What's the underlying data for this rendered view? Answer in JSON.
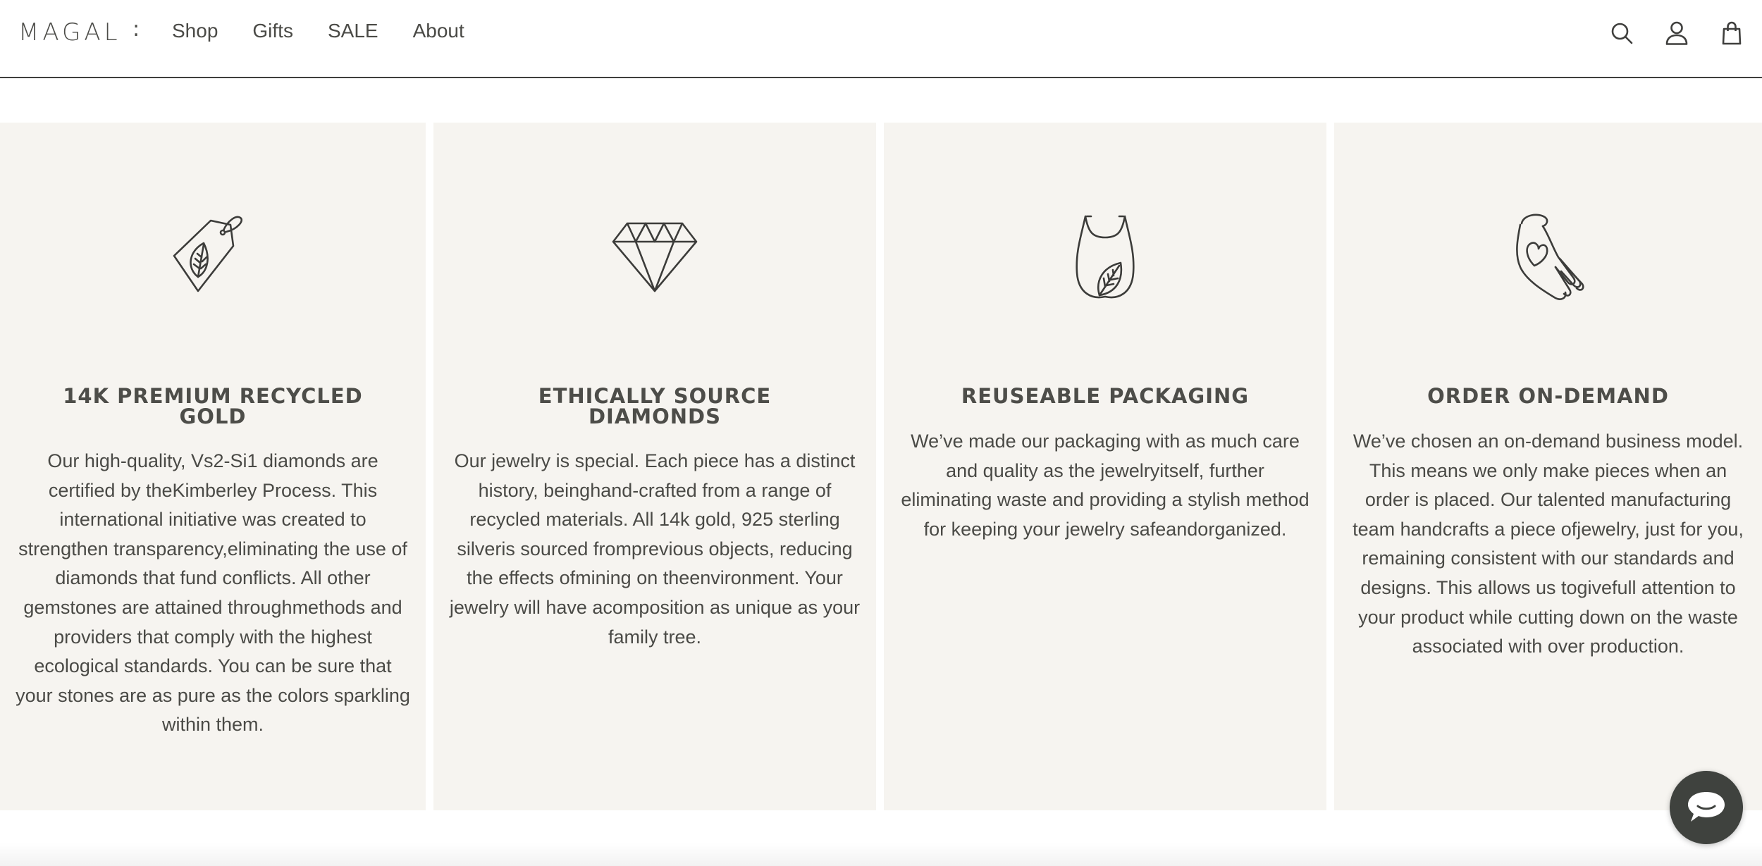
{
  "header": {
    "logo": "MAGAL",
    "logo_mark": ":",
    "nav": [
      {
        "label": "Shop"
      },
      {
        "label": "Gifts"
      },
      {
        "label": "SALE"
      },
      {
        "label": "About"
      }
    ],
    "icons": [
      "search-icon",
      "account-icon",
      "cart-bag-icon"
    ]
  },
  "features": [
    {
      "icon": "recycled-tag-leaf-icon",
      "title": "14K PREMIUM RECYCLED GOLD",
      "body": "Our high-quality, Vs2-Si1 diamonds are certified by theKimberley Process. This international initiative was created to strengthen transparency,eliminating the use of diamonds that fund conflicts. All other gemstones are attained throughmethods and providers that comply with the highest ecological standards. You can be sure that your stones are as pure as the colors sparkling within them."
    },
    {
      "icon": "diamond-icon",
      "title": "ETHICALLY SOURCE DIAMONDS",
      "body": "Our jewelry is special. Each piece has a distinct history, beinghand-crafted from a range of recycled materials. All 14k gold, 925 sterling silveris sourced fromprevious objects, reducing the effects ofmining on theenvironment. Your jewelry will have acomposition as unique as your family tree."
    },
    {
      "icon": "reusable-bag-leaf-icon",
      "title": "REUSEABLE PACKAGING",
      "body": "We’ve made our packaging with as much care and quality as the jewelryitself, further eliminating waste and providing a stylish method for keeping your jewelry safeandorganized."
    },
    {
      "icon": "hand-heart-icon",
      "title": "ORDER ON-DEMAND",
      "body": "We’ve chosen an on-demand business model. This means we only make pieces when an order is placed. Our talented manufacturing team handcrafts a piece ofjewelry, just for you, remaining consistent with our standards and designs. This allows us togivefull attention to your product while cutting down on the waste associated with over production."
    }
  ],
  "chat": {
    "icon": "chat-bubble-icon"
  },
  "colors": {
    "card_background": "#f6f4f0",
    "text": "#4a4a46",
    "chat_button": "#3f423e"
  }
}
